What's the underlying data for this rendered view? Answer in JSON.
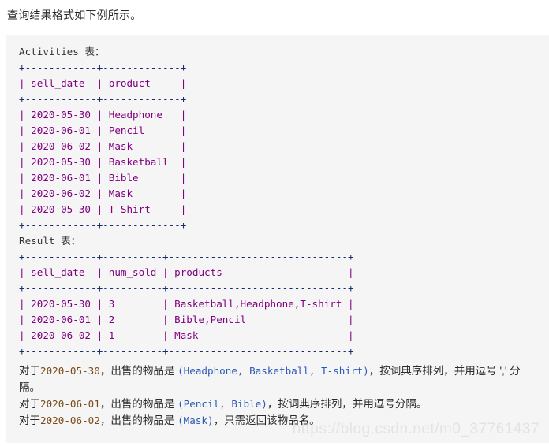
{
  "intro": {
    "text": "查询结果格式如下例所示。"
  },
  "code_block": {
    "activities": {
      "title": "Activities 表：",
      "sep_top": "+------------+-------------+",
      "header": "| sell_date  | product     |",
      "sep_mid": "+------------+-------------+",
      "rows": [
        {
          "line": "| 2020-05-30 | Headphone   |",
          "sell_date": "2020-05-30",
          "product": "Headphone"
        },
        {
          "line": "| 2020-06-01 | Pencil      |",
          "sell_date": "2020-06-01",
          "product": "Pencil"
        },
        {
          "line": "| 2020-06-02 | Mask        |",
          "sell_date": "2020-06-02",
          "product": "Mask"
        },
        {
          "line": "| 2020-05-30 | Basketball  |",
          "sell_date": "2020-05-30",
          "product": "Basketball"
        },
        {
          "line": "| 2020-06-01 | Bible       |",
          "sell_date": "2020-06-01",
          "product": "Bible"
        },
        {
          "line": "| 2020-06-02 | Mask        |",
          "sell_date": "2020-06-02",
          "product": "Mask"
        },
        {
          "line": "| 2020-05-30 | T-Shirt     |",
          "sell_date": "2020-05-30",
          "product": "T-Shirt"
        }
      ],
      "sep_bottom": "+------------+-------------+",
      "columns": [
        "sell_date",
        "product"
      ]
    },
    "result": {
      "title": "Result 表：",
      "sep_top": "+------------+----------+------------------------------+",
      "header": "| sell_date  | num_sold | products                     |",
      "sep_mid": "+------------+----------+------------------------------+",
      "rows": [
        {
          "line": "| 2020-05-30 | 3        | Basketball,Headphone,T-shirt |",
          "sell_date": "2020-05-30",
          "num_sold": "3",
          "products": "Basketball,Headphone,T-shirt"
        },
        {
          "line": "| 2020-06-01 | 2        | Bible,Pencil                 |",
          "sell_date": "2020-06-01",
          "num_sold": "2",
          "products": "Bible,Pencil"
        },
        {
          "line": "| 2020-06-02 | 1        | Mask                         |",
          "sell_date": "2020-06-02",
          "num_sold": "1",
          "products": "Mask"
        }
      ],
      "sep_bottom": "+------------+----------+------------------------------+",
      "columns": [
        "sell_date",
        "num_sold",
        "products"
      ]
    },
    "explanations": [
      {
        "prefix": "对于",
        "date": "2020-05-30",
        "mid": "，出售的物品是 ",
        "items": "(Headphone, Basketball, T-shirt)",
        "suffix": "，按词典序排列，并用逗号 ',' 分隔。"
      },
      {
        "prefix": "对于",
        "date": "2020-06-01",
        "mid": "，出售的物品是 ",
        "items": "(Pencil, Bible)",
        "suffix": "，按词典序排列，并用逗号分隔。"
      },
      {
        "prefix": "对于",
        "date": "2020-06-02",
        "mid": "，出售的物品是 ",
        "items": "(Mask)",
        "suffix": "，只需返回该物品名。"
      }
    ]
  },
  "watermark": {
    "text": "https://blog.csdn.net/m0_37761437"
  },
  "colors": {
    "page_background": "#ffffff",
    "code_background": "#f5f5f5",
    "pipe": "#800080",
    "dash": "#1b2a6b",
    "text": "#333333",
    "punctuation": "#2a59b8",
    "prose_number": "#7a4b19",
    "watermark": "#e3e3e3"
  }
}
